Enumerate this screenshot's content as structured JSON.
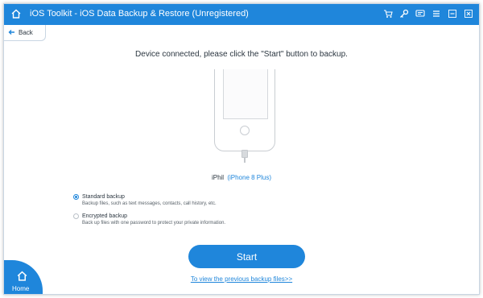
{
  "window": {
    "title": "iOS Toolkit - iOS Data Backup & Restore (Unregistered)",
    "controls": [
      "cart-icon",
      "key-icon",
      "chat-icon",
      "menu-icon",
      "minimize-icon",
      "close-icon"
    ],
    "accent_color": "#1f86db"
  },
  "nav": {
    "back_label": "Back"
  },
  "main": {
    "headline": "Device connected, please click the \"Start\" button to backup.",
    "device_name": "iPhil",
    "device_model": "(iPhone 8 Plus)"
  },
  "options": [
    {
      "title": "Standard backup",
      "desc": "Backup files, such as text messages, contacts, call history, etc.",
      "selected": true
    },
    {
      "title": "Encrypted backup",
      "desc": "Back up files with one password to protect your private information.",
      "selected": false
    }
  ],
  "actions": {
    "start_label": "Start",
    "prev_link": "To view the previous backup files>>"
  },
  "corner": {
    "home_label": "Home"
  }
}
